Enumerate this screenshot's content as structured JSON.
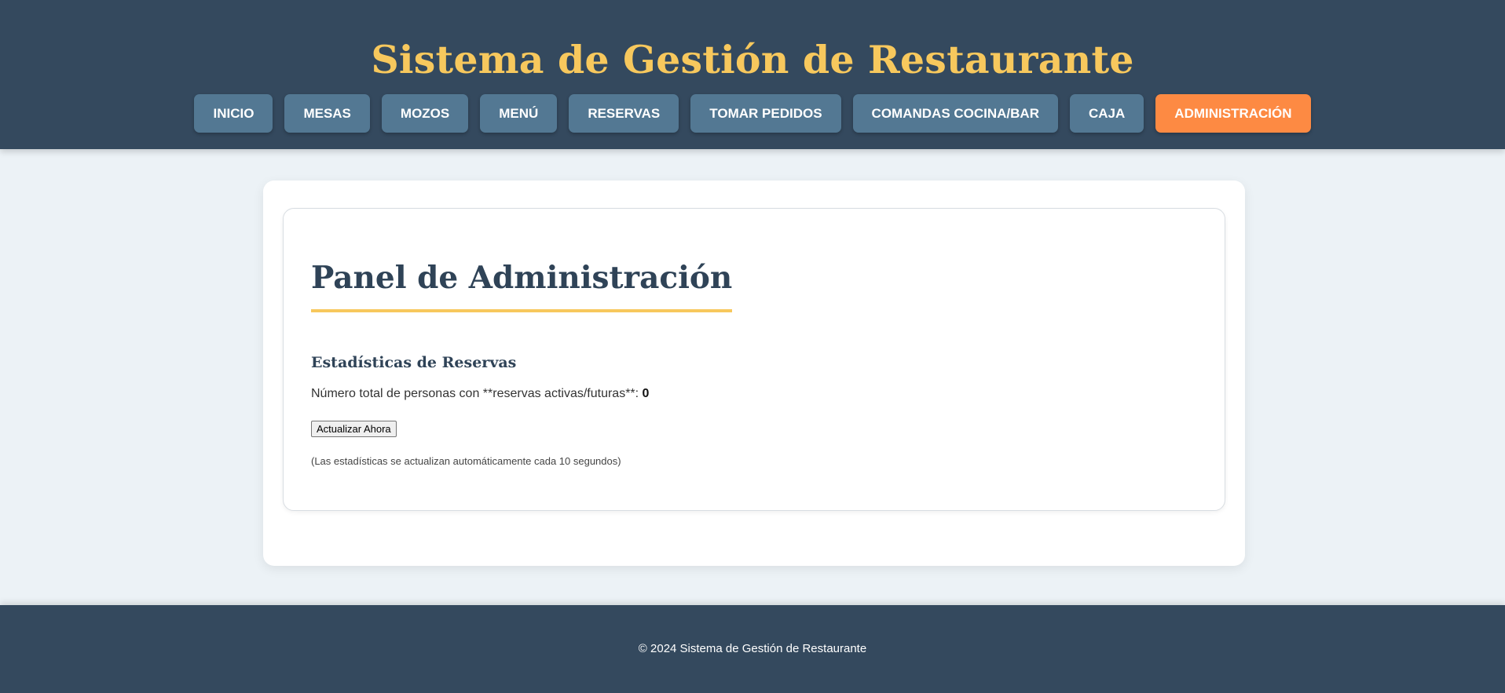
{
  "header": {
    "title": "Sistema de Gestión de Restaurante",
    "nav": [
      {
        "label": "INICIO",
        "active": false
      },
      {
        "label": "MESAS",
        "active": false
      },
      {
        "label": "MOZOS",
        "active": false
      },
      {
        "label": "MENÚ",
        "active": false
      },
      {
        "label": "RESERVAS",
        "active": false
      },
      {
        "label": "TOMAR PEDIDOS",
        "active": false
      },
      {
        "label": "COMANDAS COCINA/BAR",
        "active": false
      },
      {
        "label": "CAJA",
        "active": false
      },
      {
        "label": "ADMINISTRACIÓN",
        "active": true
      }
    ]
  },
  "main": {
    "panel_title": "Panel de Administración",
    "section_title": "Estadísticas de Reservas",
    "stat_label": "Número total de personas con **reservas activas/futuras**: ",
    "stat_value": "0",
    "refresh_button": "Actualizar Ahora",
    "note": "(Las estadísticas se actualizan automáticamente cada 10 segundos)"
  },
  "footer": {
    "text": "© 2024 Sistema de Gestión de Restaurante"
  },
  "colors": {
    "header_bg": "#34495e",
    "title": "#f7c85d",
    "nav_button": "#537893",
    "nav_active": "#fd8a43",
    "page_bg": "#ecf2f6",
    "heading": "#2f4357",
    "accent_underline": "#f7c85d"
  }
}
